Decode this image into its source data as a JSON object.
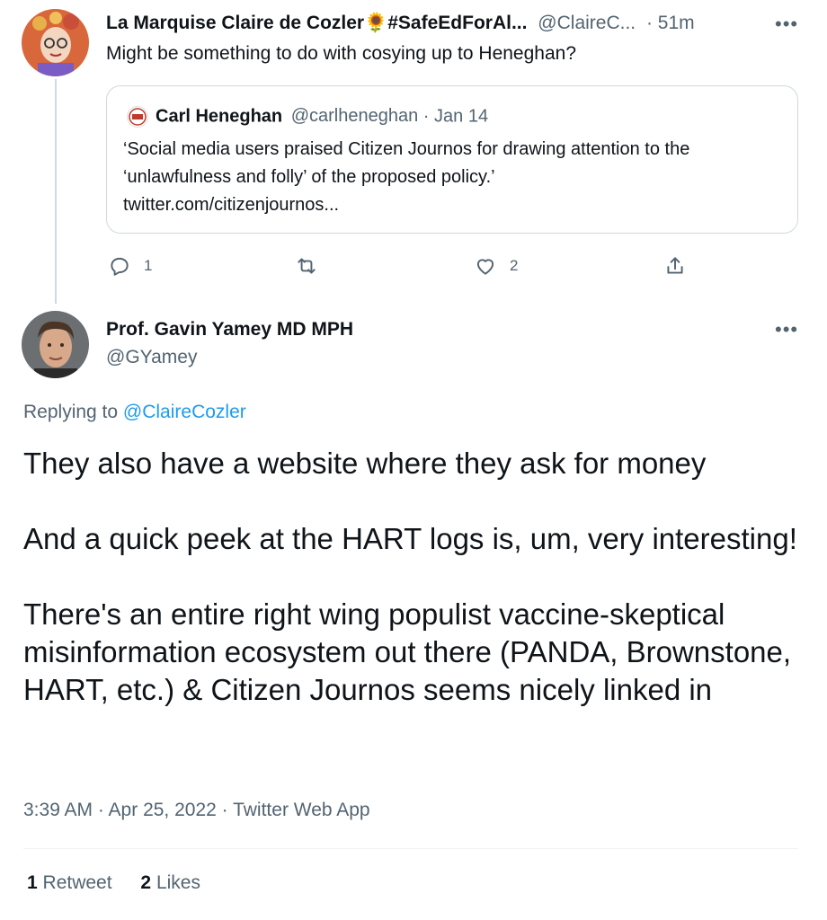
{
  "tweet1": {
    "name": "La Marquise Claire de Cozler",
    "name_emoji": "🌻",
    "hashtag": "#SafeEdForAl...",
    "handle": "@ClaireC...",
    "time": "· 51m",
    "more": "•••",
    "text": "Might be something to do with cosying up to Heneghan?",
    "quote": {
      "name": "Carl Heneghan",
      "handle": "@carlheneghan",
      "date": "· Jan 14",
      "text": "‘Social media users praised Citizen Journos for drawing attention to the ‘unlawfulness and folly’ of the proposed policy.’",
      "link": "twitter.com/citizenjournos..."
    },
    "actions": {
      "reply_count": "1",
      "retweet_count": "",
      "like_count": "2"
    }
  },
  "tweet2": {
    "name": "Prof. Gavin Yamey MD MPH",
    "handle": "@GYamey",
    "more": "•••",
    "replying_prefix": "Replying to",
    "replying_to": "@ClaireCozler",
    "text": "They also have a website where they ask for money\n\nAnd a quick peek at the HART logs is, um, very interesting!\n\nThere's an entire right wing populist vaccine-skeptical misinformation ecosystem out there (PANDA, Brownstone, HART, etc.) & Citizen Journos seems nicely linked in",
    "meta": "3:39 AM · Apr 25, 2022 · Twitter Web App",
    "retweets": {
      "count": "1",
      "label": "Retweet"
    },
    "likes": {
      "count": "2",
      "label": "Likes"
    }
  },
  "colors": {
    "accent": "#1d9bf0",
    "secondary": "#536471",
    "border": "#cfd9de"
  }
}
